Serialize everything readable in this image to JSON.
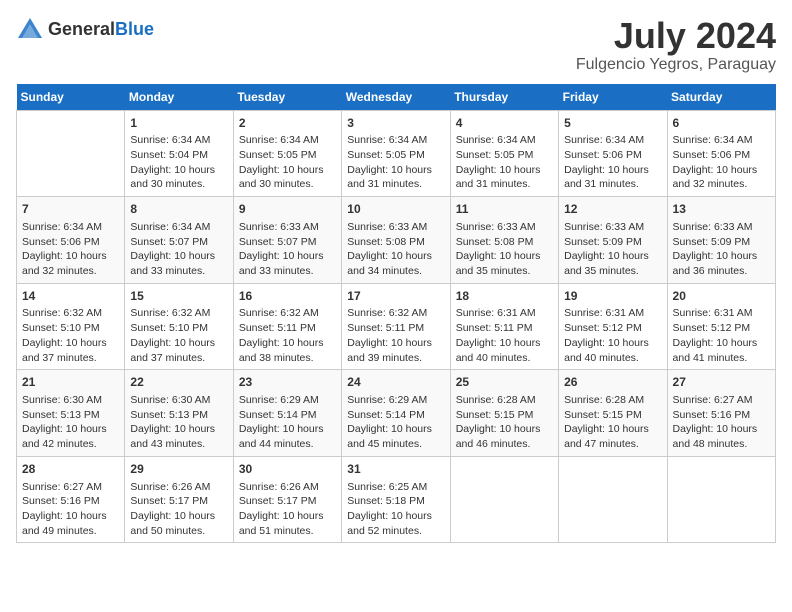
{
  "header": {
    "logo_general": "General",
    "logo_blue": "Blue",
    "month": "July 2024",
    "location": "Fulgencio Yegros, Paraguay"
  },
  "weekdays": [
    "Sunday",
    "Monday",
    "Tuesday",
    "Wednesday",
    "Thursday",
    "Friday",
    "Saturday"
  ],
  "weeks": [
    [
      {
        "day": "",
        "sunrise": "",
        "sunset": "",
        "daylight": ""
      },
      {
        "day": "1",
        "sunrise": "Sunrise: 6:34 AM",
        "sunset": "Sunset: 5:04 PM",
        "daylight": "Daylight: 10 hours and 30 minutes."
      },
      {
        "day": "2",
        "sunrise": "Sunrise: 6:34 AM",
        "sunset": "Sunset: 5:05 PM",
        "daylight": "Daylight: 10 hours and 30 minutes."
      },
      {
        "day": "3",
        "sunrise": "Sunrise: 6:34 AM",
        "sunset": "Sunset: 5:05 PM",
        "daylight": "Daylight: 10 hours and 31 minutes."
      },
      {
        "day": "4",
        "sunrise": "Sunrise: 6:34 AM",
        "sunset": "Sunset: 5:05 PM",
        "daylight": "Daylight: 10 hours and 31 minutes."
      },
      {
        "day": "5",
        "sunrise": "Sunrise: 6:34 AM",
        "sunset": "Sunset: 5:06 PM",
        "daylight": "Daylight: 10 hours and 31 minutes."
      },
      {
        "day": "6",
        "sunrise": "Sunrise: 6:34 AM",
        "sunset": "Sunset: 5:06 PM",
        "daylight": "Daylight: 10 hours and 32 minutes."
      }
    ],
    [
      {
        "day": "7",
        "sunrise": "Sunrise: 6:34 AM",
        "sunset": "Sunset: 5:06 PM",
        "daylight": "Daylight: 10 hours and 32 minutes."
      },
      {
        "day": "8",
        "sunrise": "Sunrise: 6:34 AM",
        "sunset": "Sunset: 5:07 PM",
        "daylight": "Daylight: 10 hours and 33 minutes."
      },
      {
        "day": "9",
        "sunrise": "Sunrise: 6:33 AM",
        "sunset": "Sunset: 5:07 PM",
        "daylight": "Daylight: 10 hours and 33 minutes."
      },
      {
        "day": "10",
        "sunrise": "Sunrise: 6:33 AM",
        "sunset": "Sunset: 5:08 PM",
        "daylight": "Daylight: 10 hours and 34 minutes."
      },
      {
        "day": "11",
        "sunrise": "Sunrise: 6:33 AM",
        "sunset": "Sunset: 5:08 PM",
        "daylight": "Daylight: 10 hours and 35 minutes."
      },
      {
        "day": "12",
        "sunrise": "Sunrise: 6:33 AM",
        "sunset": "Sunset: 5:09 PM",
        "daylight": "Daylight: 10 hours and 35 minutes."
      },
      {
        "day": "13",
        "sunrise": "Sunrise: 6:33 AM",
        "sunset": "Sunset: 5:09 PM",
        "daylight": "Daylight: 10 hours and 36 minutes."
      }
    ],
    [
      {
        "day": "14",
        "sunrise": "Sunrise: 6:32 AM",
        "sunset": "Sunset: 5:10 PM",
        "daylight": "Daylight: 10 hours and 37 minutes."
      },
      {
        "day": "15",
        "sunrise": "Sunrise: 6:32 AM",
        "sunset": "Sunset: 5:10 PM",
        "daylight": "Daylight: 10 hours and 37 minutes."
      },
      {
        "day": "16",
        "sunrise": "Sunrise: 6:32 AM",
        "sunset": "Sunset: 5:11 PM",
        "daylight": "Daylight: 10 hours and 38 minutes."
      },
      {
        "day": "17",
        "sunrise": "Sunrise: 6:32 AM",
        "sunset": "Sunset: 5:11 PM",
        "daylight": "Daylight: 10 hours and 39 minutes."
      },
      {
        "day": "18",
        "sunrise": "Sunrise: 6:31 AM",
        "sunset": "Sunset: 5:11 PM",
        "daylight": "Daylight: 10 hours and 40 minutes."
      },
      {
        "day": "19",
        "sunrise": "Sunrise: 6:31 AM",
        "sunset": "Sunset: 5:12 PM",
        "daylight": "Daylight: 10 hours and 40 minutes."
      },
      {
        "day": "20",
        "sunrise": "Sunrise: 6:31 AM",
        "sunset": "Sunset: 5:12 PM",
        "daylight": "Daylight: 10 hours and 41 minutes."
      }
    ],
    [
      {
        "day": "21",
        "sunrise": "Sunrise: 6:30 AM",
        "sunset": "Sunset: 5:13 PM",
        "daylight": "Daylight: 10 hours and 42 minutes."
      },
      {
        "day": "22",
        "sunrise": "Sunrise: 6:30 AM",
        "sunset": "Sunset: 5:13 PM",
        "daylight": "Daylight: 10 hours and 43 minutes."
      },
      {
        "day": "23",
        "sunrise": "Sunrise: 6:29 AM",
        "sunset": "Sunset: 5:14 PM",
        "daylight": "Daylight: 10 hours and 44 minutes."
      },
      {
        "day": "24",
        "sunrise": "Sunrise: 6:29 AM",
        "sunset": "Sunset: 5:14 PM",
        "daylight": "Daylight: 10 hours and 45 minutes."
      },
      {
        "day": "25",
        "sunrise": "Sunrise: 6:28 AM",
        "sunset": "Sunset: 5:15 PM",
        "daylight": "Daylight: 10 hours and 46 minutes."
      },
      {
        "day": "26",
        "sunrise": "Sunrise: 6:28 AM",
        "sunset": "Sunset: 5:15 PM",
        "daylight": "Daylight: 10 hours and 47 minutes."
      },
      {
        "day": "27",
        "sunrise": "Sunrise: 6:27 AM",
        "sunset": "Sunset: 5:16 PM",
        "daylight": "Daylight: 10 hours and 48 minutes."
      }
    ],
    [
      {
        "day": "28",
        "sunrise": "Sunrise: 6:27 AM",
        "sunset": "Sunset: 5:16 PM",
        "daylight": "Daylight: 10 hours and 49 minutes."
      },
      {
        "day": "29",
        "sunrise": "Sunrise: 6:26 AM",
        "sunset": "Sunset: 5:17 PM",
        "daylight": "Daylight: 10 hours and 50 minutes."
      },
      {
        "day": "30",
        "sunrise": "Sunrise: 6:26 AM",
        "sunset": "Sunset: 5:17 PM",
        "daylight": "Daylight: 10 hours and 51 minutes."
      },
      {
        "day": "31",
        "sunrise": "Sunrise: 6:25 AM",
        "sunset": "Sunset: 5:18 PM",
        "daylight": "Daylight: 10 hours and 52 minutes."
      },
      {
        "day": "",
        "sunrise": "",
        "sunset": "",
        "daylight": ""
      },
      {
        "day": "",
        "sunrise": "",
        "sunset": "",
        "daylight": ""
      },
      {
        "day": "",
        "sunrise": "",
        "sunset": "",
        "daylight": ""
      }
    ]
  ]
}
